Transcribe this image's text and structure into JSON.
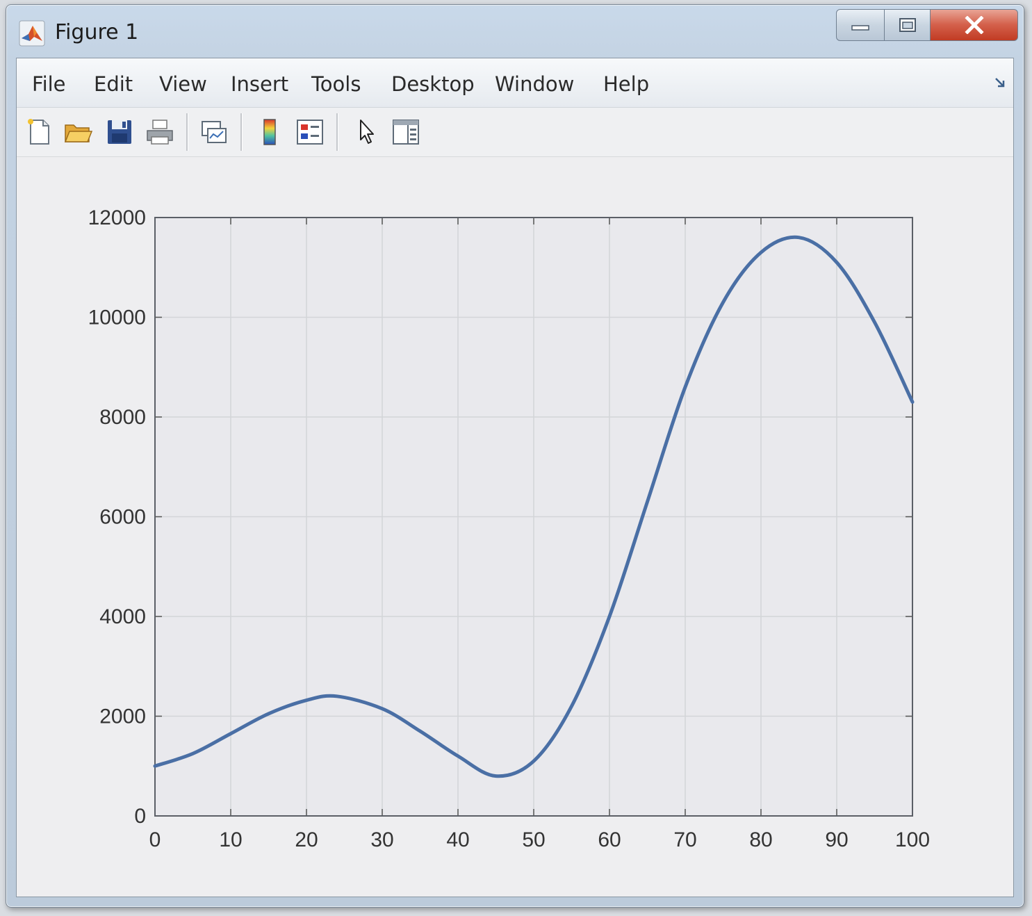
{
  "window": {
    "title": "Figure 1",
    "app_icon": "matlab-logo-icon",
    "controls": [
      "minimize-icon",
      "maximize-icon",
      "close-icon"
    ]
  },
  "menu": {
    "items": [
      "File",
      "Edit",
      "View",
      "Insert",
      "Tools",
      "Desktop",
      "Window",
      "Help"
    ]
  },
  "toolbar": {
    "tools": [
      "new-figure-icon",
      "open-file-icon",
      "save-icon",
      "print-icon",
      "link-plot-icon",
      "insert-colorbar-icon",
      "insert-legend-icon",
      "edit-plot-icon",
      "show-plot-tools-icon"
    ]
  },
  "colors": {
    "line": "#4a6fa5",
    "grid": "#d3d5d8",
    "axes_bg": "#e9e9ed"
  },
  "chart_data": {
    "type": "line",
    "title": "",
    "xlabel": "",
    "ylabel": "",
    "xlim": [
      0,
      100
    ],
    "ylim": [
      0,
      12000
    ],
    "xticks": [
      0,
      10,
      20,
      30,
      40,
      50,
      60,
      70,
      80,
      90,
      100
    ],
    "yticks": [
      0,
      2000,
      4000,
      6000,
      8000,
      10000,
      12000
    ],
    "grid": true,
    "series": [
      {
        "x": [
          0,
          5,
          10,
          15,
          20,
          24,
          30,
          35,
          40,
          45,
          50,
          55,
          60,
          65,
          70,
          75,
          80,
          85,
          90,
          95,
          100
        ],
        "y": [
          1000,
          1250,
          1650,
          2050,
          2320,
          2400,
          2150,
          1700,
          1200,
          800,
          1100,
          2200,
          4000,
          6300,
          8600,
          10300,
          11300,
          11600,
          11100,
          9900,
          8300
        ]
      }
    ]
  }
}
